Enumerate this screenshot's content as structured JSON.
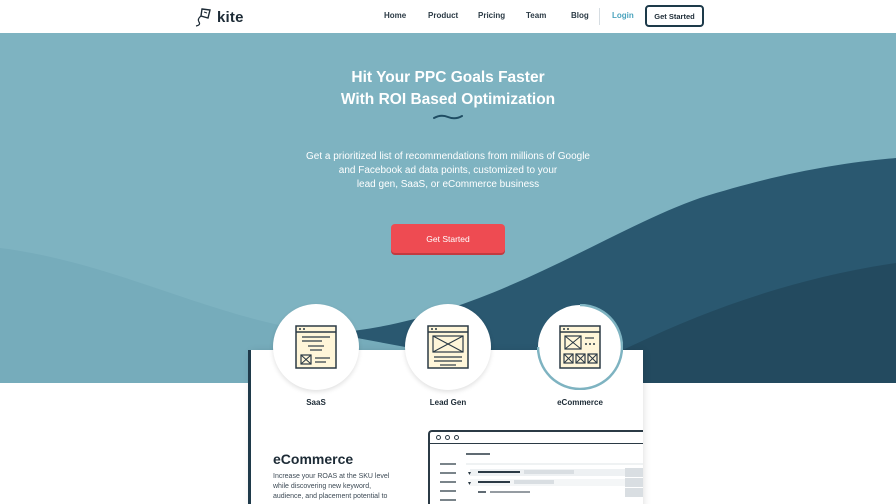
{
  "nav": {
    "logo_text": "kite",
    "links": [
      "Home",
      "Product",
      "Pricing",
      "Team",
      "Blog"
    ],
    "login": "Login",
    "cta": "Get Started"
  },
  "hero": {
    "title_line1": "Hit Your PPC Goals Faster",
    "title_line2": "With ROI Based Optimization",
    "sub_line1": "Get a prioritized list of recommendations from millions of Google",
    "sub_line2": "and Facebook ad data points, customized to your",
    "sub_line3": "lead gen, SaaS, or eCommerce business",
    "cta": "Get Started"
  },
  "segments": [
    {
      "label": "SaaS",
      "icon": "saas-wireframe-icon"
    },
    {
      "label": "Lead Gen",
      "icon": "leadgen-wireframe-icon"
    },
    {
      "label": "eCommerce",
      "icon": "ecommerce-wireframe-icon",
      "selected": true
    }
  ],
  "card": {
    "heading": "eCommerce",
    "text_line1": "Increase your ROAS at the SKU level",
    "text_line2": "while discovering new keyword,",
    "text_line3": "audience, and placement potential to"
  },
  "colors": {
    "hero_bg": "#7eb3c1",
    "hero_dark": "#274f65",
    "cta_red": "#ee4b52",
    "accent_teal": "#4aa3bd",
    "ink": "#1d2b36",
    "icon_cream": "#fff6d9"
  }
}
